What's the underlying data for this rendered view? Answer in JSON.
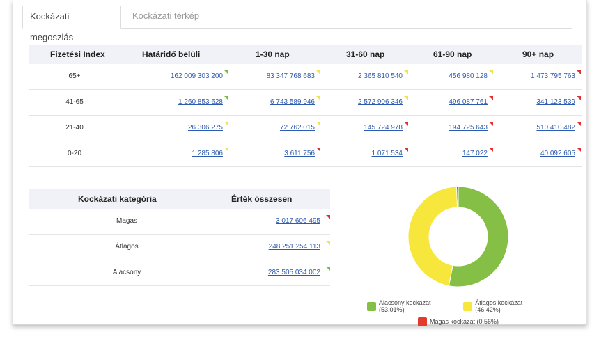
{
  "tabs": [
    {
      "label": "Kockázati megoszlás",
      "active": true
    },
    {
      "label": "Kockázati térkép",
      "active": false
    }
  ],
  "aging_table": {
    "headers": [
      "Fizetési Index",
      "Határidő belüli",
      "1-30 nap",
      "31-60 nap",
      "61-90 nap",
      "90+ nap"
    ],
    "rows": [
      {
        "label": "65+",
        "cells": [
          {
            "value": "162 009 303 200",
            "flag": "green"
          },
          {
            "value": "83 347 768 683",
            "flag": "yellow"
          },
          {
            "value": "2 365 810 540",
            "flag": "yellow"
          },
          {
            "value": "456 980 128",
            "flag": "yellow"
          },
          {
            "value": "1 473 795 763",
            "flag": "red"
          }
        ]
      },
      {
        "label": "41-65",
        "cells": [
          {
            "value": "1 260 853 628",
            "flag": "green"
          },
          {
            "value": "6 743 589 946",
            "flag": "yellow"
          },
          {
            "value": "2 572 906 346",
            "flag": "yellow"
          },
          {
            "value": "496 087 761",
            "flag": "red"
          },
          {
            "value": "341 123 539",
            "flag": "red"
          }
        ]
      },
      {
        "label": "21-40",
        "cells": [
          {
            "value": "26 306 275",
            "flag": "yellow"
          },
          {
            "value": "72 762 015",
            "flag": "yellow"
          },
          {
            "value": "145 724 978",
            "flag": "red"
          },
          {
            "value": "194 725 643",
            "flag": "red"
          },
          {
            "value": "510 410 482",
            "flag": "red"
          }
        ]
      },
      {
        "label": "0-20",
        "cells": [
          {
            "value": "1 285 806",
            "flag": "yellow"
          },
          {
            "value": "3 611 756",
            "flag": "red"
          },
          {
            "value": "1 071 534",
            "flag": "red"
          },
          {
            "value": "147 022",
            "flag": "red"
          },
          {
            "value": "40 092 605",
            "flag": "red"
          }
        ]
      }
    ]
  },
  "category_table": {
    "headers": [
      "Kockázati kategória",
      "Érték összesen"
    ],
    "rows": [
      {
        "label": "Magas",
        "value": "3 017 606 495",
        "flag": "red"
      },
      {
        "label": "Átlagos",
        "value": "248 251 254 113",
        "flag": "yellow"
      },
      {
        "label": "Alacsony",
        "value": "283 505 034 002",
        "flag": "green"
      }
    ]
  },
  "colors": {
    "green": "#86bf45",
    "yellow": "#f7e63c",
    "red": "#e23a2e",
    "link": "#2d5bb0"
  },
  "chart_data": {
    "type": "pie",
    "donut": true,
    "slices": [
      {
        "name": "Alacsony kockázat",
        "value": 53.01,
        "label": "Alacsony kockázat (53.01%)",
        "color": "#86bf45"
      },
      {
        "name": "Átlagos kockázat",
        "value": 46.42,
        "label": "Átlagos kockázat (46.42%)",
        "color": "#f7e63c"
      },
      {
        "name": "Magas kockázat",
        "value": 0.56,
        "label": "Magas kockázat (0.56%)",
        "color": "#e23a2e"
      }
    ],
    "legend_placement": "bottom"
  }
}
